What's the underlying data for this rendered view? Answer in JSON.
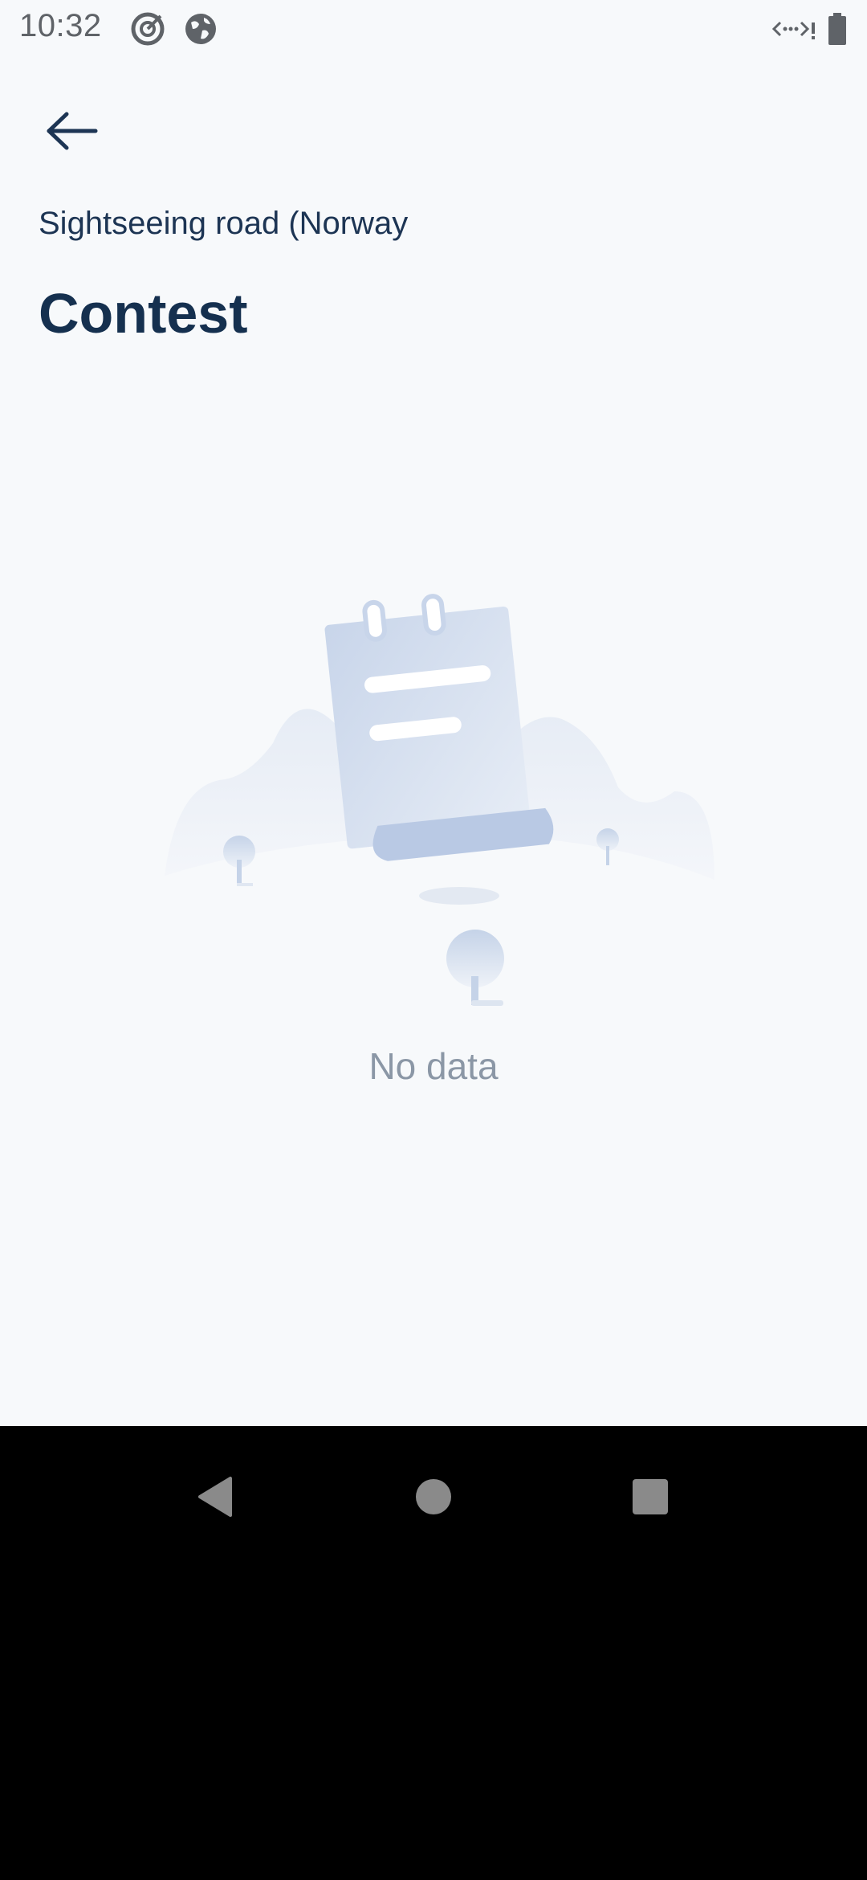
{
  "status_bar": {
    "time": "10:32",
    "icons": [
      "target-icon",
      "globe-icon",
      "data-transfer-icon",
      "battery-icon"
    ]
  },
  "header": {
    "back_icon": "arrow-left-icon",
    "subtitle": "Sightseeing road (Norway",
    "title": "Contest"
  },
  "empty_state": {
    "illustration": "empty-clipboard-landscape",
    "message": "No data"
  },
  "nav_bar": {
    "buttons": [
      "back-triangle-icon",
      "home-circle-icon",
      "recents-square-icon"
    ]
  },
  "colors": {
    "background": "#f7f9fb",
    "title": "#15304f",
    "subtitle": "#1d3554",
    "muted_text": "#8b97a6",
    "nav_bar": "#000000"
  }
}
